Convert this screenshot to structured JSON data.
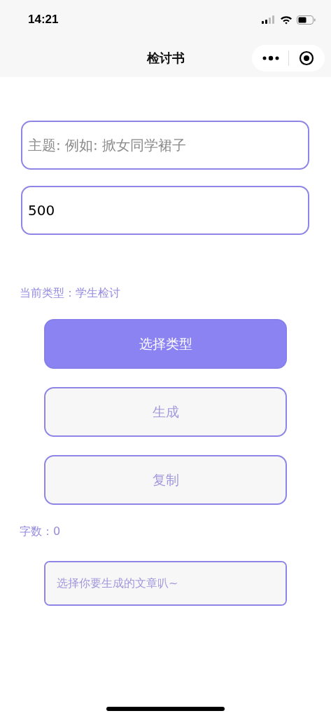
{
  "status_bar": {
    "time": "14:21"
  },
  "nav": {
    "title": "检讨书"
  },
  "topic_field": {
    "placeholder": "主题: 例如: 掀女同学裙子"
  },
  "count_field": {
    "value": "500"
  },
  "current_type": "当前类型：学生检讨",
  "buttons": [
    {
      "label": "选择类型",
      "kind": "primary"
    },
    {
      "label": "生成",
      "kind": "secondary"
    },
    {
      "label": "复制",
      "kind": "secondary"
    }
  ],
  "word_count": "字数：0",
  "output": {
    "placeholder": "选择你要生成的文章叭~"
  }
}
